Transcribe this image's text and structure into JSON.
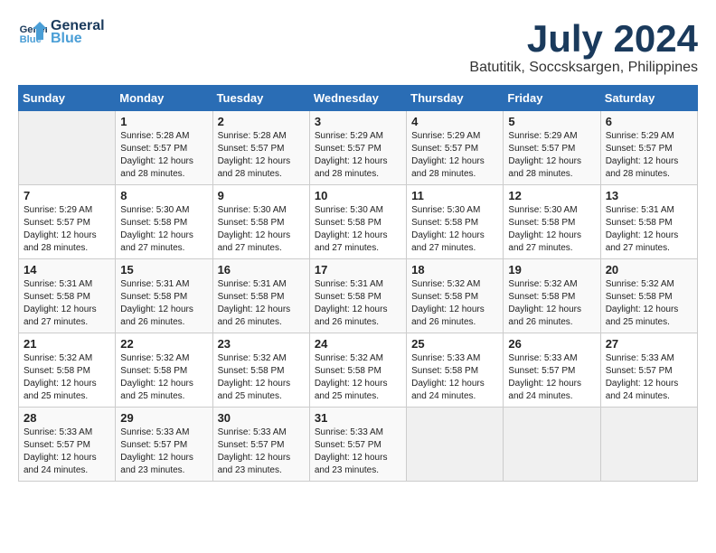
{
  "header": {
    "logo_line1": "General",
    "logo_line2": "Blue",
    "title": "July 2024",
    "subtitle": "Batutitik, Soccsksargen, Philippines"
  },
  "columns": [
    "Sunday",
    "Monday",
    "Tuesday",
    "Wednesday",
    "Thursday",
    "Friday",
    "Saturday"
  ],
  "weeks": [
    [
      {
        "day": "",
        "info": ""
      },
      {
        "day": "1",
        "info": "Sunrise: 5:28 AM\nSunset: 5:57 PM\nDaylight: 12 hours\nand 28 minutes."
      },
      {
        "day": "2",
        "info": "Sunrise: 5:28 AM\nSunset: 5:57 PM\nDaylight: 12 hours\nand 28 minutes."
      },
      {
        "day": "3",
        "info": "Sunrise: 5:29 AM\nSunset: 5:57 PM\nDaylight: 12 hours\nand 28 minutes."
      },
      {
        "day": "4",
        "info": "Sunrise: 5:29 AM\nSunset: 5:57 PM\nDaylight: 12 hours\nand 28 minutes."
      },
      {
        "day": "5",
        "info": "Sunrise: 5:29 AM\nSunset: 5:57 PM\nDaylight: 12 hours\nand 28 minutes."
      },
      {
        "day": "6",
        "info": "Sunrise: 5:29 AM\nSunset: 5:57 PM\nDaylight: 12 hours\nand 28 minutes."
      }
    ],
    [
      {
        "day": "7",
        "info": "Sunrise: 5:29 AM\nSunset: 5:57 PM\nDaylight: 12 hours\nand 28 minutes."
      },
      {
        "day": "8",
        "info": "Sunrise: 5:30 AM\nSunset: 5:58 PM\nDaylight: 12 hours\nand 27 minutes."
      },
      {
        "day": "9",
        "info": "Sunrise: 5:30 AM\nSunset: 5:58 PM\nDaylight: 12 hours\nand 27 minutes."
      },
      {
        "day": "10",
        "info": "Sunrise: 5:30 AM\nSunset: 5:58 PM\nDaylight: 12 hours\nand 27 minutes."
      },
      {
        "day": "11",
        "info": "Sunrise: 5:30 AM\nSunset: 5:58 PM\nDaylight: 12 hours\nand 27 minutes."
      },
      {
        "day": "12",
        "info": "Sunrise: 5:30 AM\nSunset: 5:58 PM\nDaylight: 12 hours\nand 27 minutes."
      },
      {
        "day": "13",
        "info": "Sunrise: 5:31 AM\nSunset: 5:58 PM\nDaylight: 12 hours\nand 27 minutes."
      }
    ],
    [
      {
        "day": "14",
        "info": "Sunrise: 5:31 AM\nSunset: 5:58 PM\nDaylight: 12 hours\nand 27 minutes."
      },
      {
        "day": "15",
        "info": "Sunrise: 5:31 AM\nSunset: 5:58 PM\nDaylight: 12 hours\nand 26 minutes."
      },
      {
        "day": "16",
        "info": "Sunrise: 5:31 AM\nSunset: 5:58 PM\nDaylight: 12 hours\nand 26 minutes."
      },
      {
        "day": "17",
        "info": "Sunrise: 5:31 AM\nSunset: 5:58 PM\nDaylight: 12 hours\nand 26 minutes."
      },
      {
        "day": "18",
        "info": "Sunrise: 5:32 AM\nSunset: 5:58 PM\nDaylight: 12 hours\nand 26 minutes."
      },
      {
        "day": "19",
        "info": "Sunrise: 5:32 AM\nSunset: 5:58 PM\nDaylight: 12 hours\nand 26 minutes."
      },
      {
        "day": "20",
        "info": "Sunrise: 5:32 AM\nSunset: 5:58 PM\nDaylight: 12 hours\nand 25 minutes."
      }
    ],
    [
      {
        "day": "21",
        "info": "Sunrise: 5:32 AM\nSunset: 5:58 PM\nDaylight: 12 hours\nand 25 minutes."
      },
      {
        "day": "22",
        "info": "Sunrise: 5:32 AM\nSunset: 5:58 PM\nDaylight: 12 hours\nand 25 minutes."
      },
      {
        "day": "23",
        "info": "Sunrise: 5:32 AM\nSunset: 5:58 PM\nDaylight: 12 hours\nand 25 minutes."
      },
      {
        "day": "24",
        "info": "Sunrise: 5:32 AM\nSunset: 5:58 PM\nDaylight: 12 hours\nand 25 minutes."
      },
      {
        "day": "25",
        "info": "Sunrise: 5:33 AM\nSunset: 5:58 PM\nDaylight: 12 hours\nand 24 minutes."
      },
      {
        "day": "26",
        "info": "Sunrise: 5:33 AM\nSunset: 5:57 PM\nDaylight: 12 hours\nand 24 minutes."
      },
      {
        "day": "27",
        "info": "Sunrise: 5:33 AM\nSunset: 5:57 PM\nDaylight: 12 hours\nand 24 minutes."
      }
    ],
    [
      {
        "day": "28",
        "info": "Sunrise: 5:33 AM\nSunset: 5:57 PM\nDaylight: 12 hours\nand 24 minutes."
      },
      {
        "day": "29",
        "info": "Sunrise: 5:33 AM\nSunset: 5:57 PM\nDaylight: 12 hours\nand 23 minutes."
      },
      {
        "day": "30",
        "info": "Sunrise: 5:33 AM\nSunset: 5:57 PM\nDaylight: 12 hours\nand 23 minutes."
      },
      {
        "day": "31",
        "info": "Sunrise: 5:33 AM\nSunset: 5:57 PM\nDaylight: 12 hours\nand 23 minutes."
      },
      {
        "day": "",
        "info": ""
      },
      {
        "day": "",
        "info": ""
      },
      {
        "day": "",
        "info": ""
      }
    ]
  ]
}
